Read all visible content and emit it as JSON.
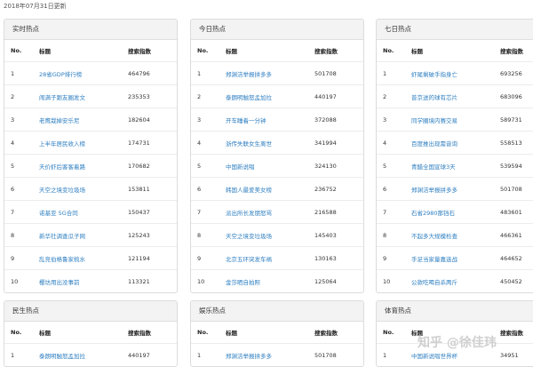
{
  "updated_text": "2018年07月31日更新",
  "panels": [
    {
      "title": "实时热点",
      "headers": {
        "no": "No.",
        "title": "标题",
        "index": "搜索指数"
      },
      "rows": [
        {
          "no": "1",
          "title": "28省GDP排行榜",
          "index": "464796"
        },
        {
          "no": "2",
          "title": "闹满子跟友圈发文",
          "index": "235353"
        },
        {
          "no": "3",
          "title": "老鹰栽掉安乐尼",
          "index": "182604"
        },
        {
          "no": "4",
          "title": "上半年居民收入榜",
          "index": "174731"
        },
        {
          "no": "5",
          "title": "天价虾后客客着路",
          "index": "170682"
        },
        {
          "no": "6",
          "title": "天空之境变垃圾场",
          "index": "153811"
        },
        {
          "no": "7",
          "title": "诺基亚 5G合同",
          "index": "150437"
        },
        {
          "no": "8",
          "title": "新华社调查瓜子网",
          "index": "125243"
        },
        {
          "no": "9",
          "title": "乱竞伯格鲁家梳水",
          "index": "121194"
        },
        {
          "no": "10",
          "title": "樱坊用出没事前",
          "index": "113321"
        }
      ]
    },
    {
      "title": "今日热点",
      "headers": {
        "no": "No.",
        "title": "标题",
        "index": "搜索指数"
      },
      "rows": [
        {
          "no": "1",
          "title": "郑渊洁举报拼多多",
          "index": "501708"
        },
        {
          "no": "2",
          "title": "泰朗明触怒孟加拉",
          "index": "440197"
        },
        {
          "no": "3",
          "title": "开车睡着一分钟",
          "index": "372088"
        },
        {
          "no": "4",
          "title": "浙传失联女生离世",
          "index": "341994"
        },
        {
          "no": "5",
          "title": "中国新说唱",
          "index": "324130"
        },
        {
          "no": "6",
          "title": "韩国人最爱美女榜",
          "index": "236752"
        },
        {
          "no": "7",
          "title": "派出所长发朋怒骂",
          "index": "216588"
        },
        {
          "no": "8",
          "title": "天空之境变垃圾场",
          "index": "145403"
        },
        {
          "no": "9",
          "title": "北京五环突发车祸",
          "index": "130163"
        },
        {
          "no": "10",
          "title": "金莎晒自拍照",
          "index": "125064"
        }
      ]
    },
    {
      "title": "七日热点",
      "headers": {
        "no": "No.",
        "title": "标题",
        "index": "搜索指数"
      },
      "rows": [
        {
          "no": "1",
          "title": "虾尾剩破手指身亡",
          "index": "693256"
        },
        {
          "no": "2",
          "title": "普京送的球有芯片",
          "index": "683096"
        },
        {
          "no": "3",
          "title": "同学圈境内赛交易",
          "index": "589731"
        },
        {
          "no": "4",
          "title": "百度推出现需音询",
          "index": "558513"
        },
        {
          "no": "5",
          "title": "青醋全国宣球3天",
          "index": "539594"
        },
        {
          "no": "6",
          "title": "郑渊洁举报拼多多",
          "index": "501708"
        },
        {
          "no": "7",
          "title": "石省2980那铛石",
          "index": "483601"
        },
        {
          "no": "8",
          "title": "不起多大规模检查",
          "index": "466361"
        },
        {
          "no": "9",
          "title": "手足当家量嘉选战",
          "index": "464652"
        },
        {
          "no": "10",
          "title": "公款吃喝自杀两斤",
          "index": "450452"
        }
      ]
    },
    {
      "title": "民生热点",
      "headers": {
        "no": "No.",
        "title": "标题",
        "index": "搜索指数"
      },
      "rows": [
        {
          "no": "1",
          "title": "泰朗明触怒孟加拉",
          "index": "440197"
        }
      ]
    },
    {
      "title": "娱乐热点",
      "headers": {
        "no": "No.",
        "title": "标题",
        "index": "搜索指数"
      },
      "rows": [
        {
          "no": "1",
          "title": "郑渊洁举报拼多多",
          "index": "501708"
        }
      ]
    },
    {
      "title": "体育热点",
      "headers": {
        "no": "No.",
        "title": "标题",
        "index": "搜索指数"
      },
      "rows": [
        {
          "no": "1",
          "title": "中国新说唱世界杯",
          "index": "34951"
        }
      ]
    }
  ],
  "watermark": "知乎 @徐佳玮"
}
